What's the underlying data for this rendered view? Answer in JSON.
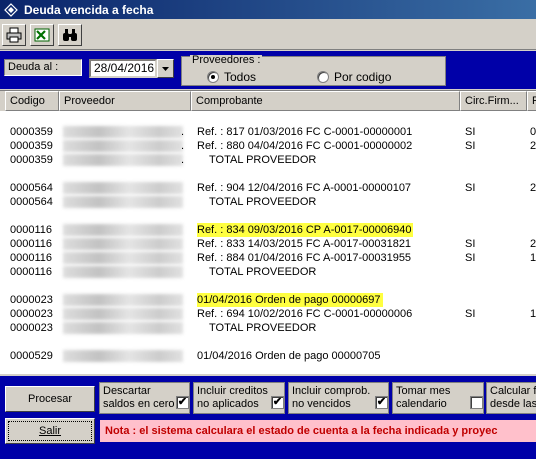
{
  "window": {
    "title": "Deuda vencida a fecha",
    "icon": "diamond-app-icon"
  },
  "toolbar": {
    "icons": [
      "printer-icon",
      "excel-icon",
      "binoculars-icon"
    ]
  },
  "filters": {
    "deuda_label": "Deuda al :",
    "date_value": "28/04/2016",
    "proveedores_legend": "Proveedores :",
    "radio_todos": "Todos",
    "radio_codigo": "Por codigo",
    "selected": "Todos"
  },
  "table": {
    "headers": [
      "Codigo",
      "Proveedor",
      "Comprobante",
      "Circ.Firm...",
      "F"
    ],
    "rows": [
      {
        "code": "0000359",
        "dot": ".",
        "comp": "Ref. : 817 01/03/2016 FC C-0001-00000001",
        "circ": "SI",
        "r": "0",
        "hl": false,
        "total": false
      },
      {
        "code": "0000359",
        "dot": ".",
        "comp": "Ref. : 880 04/04/2016 FC C-0001-00000002",
        "circ": "SI",
        "r": "2",
        "hl": false,
        "total": false
      },
      {
        "code": "0000359",
        "dot": ".",
        "comp": "TOTAL PROVEEDOR",
        "circ": "",
        "r": "",
        "hl": false,
        "total": true
      },
      {
        "code": "0000564",
        "dot": "",
        "comp": "Ref. : 904 12/04/2016 FC A-0001-00000107",
        "circ": "SI",
        "r": "2",
        "hl": false,
        "total": false
      },
      {
        "code": "0000564",
        "dot": "",
        "comp": "TOTAL PROVEEDOR",
        "circ": "",
        "r": "",
        "hl": false,
        "total": true
      },
      {
        "code": "0000116",
        "dot": "",
        "comp": "Ref. : 834 09/03/2016 CP A-0017-00006940",
        "circ": "",
        "r": "",
        "hl": true,
        "total": false
      },
      {
        "code": "0000116",
        "dot": "",
        "comp": "Ref. : 833 14/03/2015 FC A-0017-00031821",
        "circ": "SI",
        "r": "2",
        "hl": false,
        "total": false
      },
      {
        "code": "0000116",
        "dot": "",
        "comp": "Ref. : 884 01/04/2016 FC A-0017-00031955",
        "circ": "SI",
        "r": "1",
        "hl": false,
        "total": false
      },
      {
        "code": "0000116",
        "dot": "",
        "comp": "TOTAL PROVEEDOR",
        "circ": "",
        "r": "",
        "hl": false,
        "total": true
      },
      {
        "code": "0000023",
        "dot": "",
        "comp": "01/04/2016 Orden de pago 00000697",
        "circ": "",
        "r": "",
        "hl": true,
        "total": false
      },
      {
        "code": "0000023",
        "dot": "",
        "comp": "Ref. : 694 10/02/2016 FC C-0001-00000006",
        "circ": "SI",
        "r": "1",
        "hl": false,
        "total": false
      },
      {
        "code": "0000023",
        "dot": "",
        "comp": "TOTAL PROVEEDOR",
        "circ": "",
        "r": "",
        "hl": false,
        "total": true
      },
      {
        "code": "0000529",
        "dot": "",
        "comp": "01/04/2016 Orden de pago 00000705",
        "circ": "",
        "r": "",
        "hl": false,
        "total": false
      }
    ]
  },
  "bottom": {
    "procesar": "Procesar",
    "salir": "Salir",
    "options": [
      {
        "line1": "Descartar",
        "line2": "saldos en cero",
        "checked": true
      },
      {
        "line1": "Incluir creditos",
        "line2": "no aplicados",
        "checked": true
      },
      {
        "line1": "Incluir comprob.",
        "line2": "no vencidos",
        "checked": true
      },
      {
        "line1": "Tomar mes",
        "line2": "calendario",
        "checked": false
      },
      {
        "line1": "Calcular fe",
        "line2": "desde las",
        "checked": false
      }
    ],
    "nota": "Nota :  el sistema calculara el estado de cuenta a la fecha indicada y proyec"
  }
}
